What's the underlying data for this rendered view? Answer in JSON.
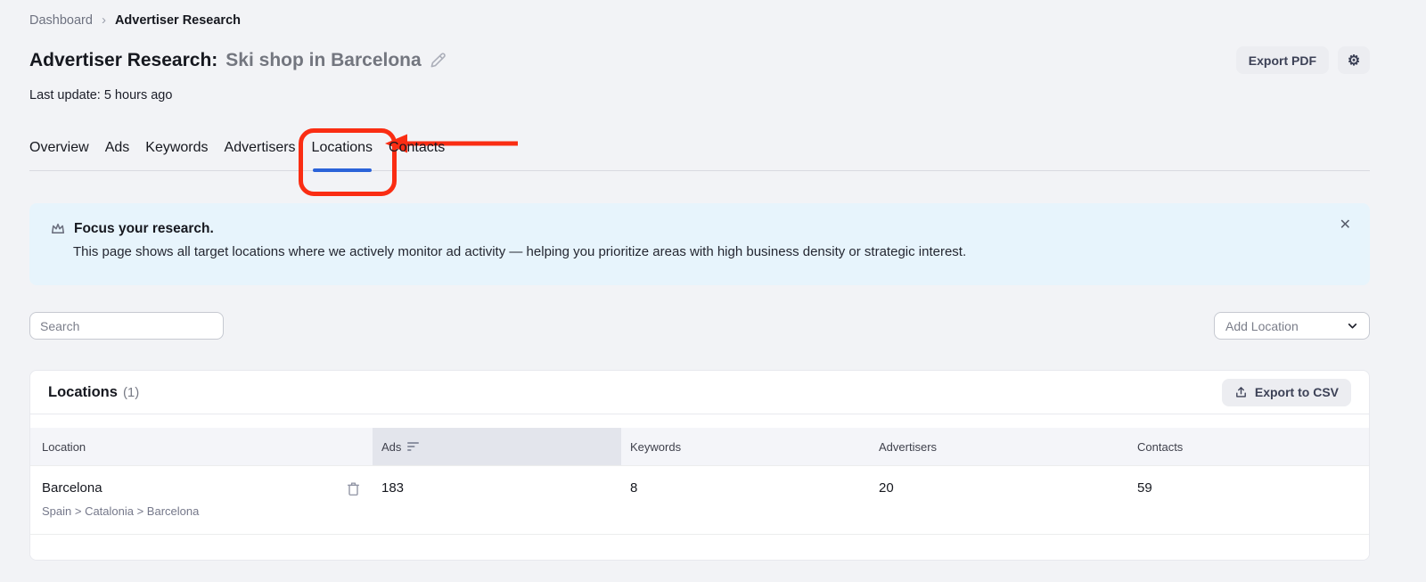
{
  "breadcrumb": {
    "items": [
      "Dashboard",
      "Advertiser Research"
    ],
    "separator": "›"
  },
  "header": {
    "title_prefix": "Advertiser Research:",
    "title_value": "Ski shop in Barcelona",
    "last_update": "Last update: 5 hours ago",
    "export_pdf_label": "Export PDF",
    "gear_glyph": "⚙"
  },
  "tabs": [
    {
      "label": "Overview",
      "active": false
    },
    {
      "label": "Ads",
      "active": false
    },
    {
      "label": "Keywords",
      "active": false
    },
    {
      "label": "Advertisers",
      "active": false
    },
    {
      "label": "Locations",
      "active": true
    },
    {
      "label": "Contacts",
      "active": false
    }
  ],
  "banner": {
    "title": "Focus your research.",
    "body": "This page shows all target locations where we actively monitor ad activity — helping you prioritize areas with high business density or strategic interest.",
    "close_glyph": "✕"
  },
  "toolbar": {
    "search_placeholder": "Search",
    "add_location_label": "Add Location"
  },
  "card": {
    "title": "Locations",
    "count": "(1)",
    "export_csv_label": "Export to CSV",
    "table": {
      "columns": [
        "Location",
        "Ads",
        "Keywords",
        "Advertisers",
        "Contacts"
      ],
      "sorted_column": "Ads",
      "rows": [
        {
          "location": "Barcelona",
          "path": "Spain > Catalonia > Barcelona",
          "ads": "183",
          "keywords": "8",
          "advertisers": "20",
          "contacts": "59"
        }
      ]
    }
  },
  "colors": {
    "accent_blue": "#2b63d9",
    "annotation_red": "#fa2d13",
    "banner_bg": "#e7f4fc",
    "page_bg": "#f2f3f6",
    "button_bg": "#ecedf1",
    "sorted_header_bg": "#e3e5ec"
  }
}
